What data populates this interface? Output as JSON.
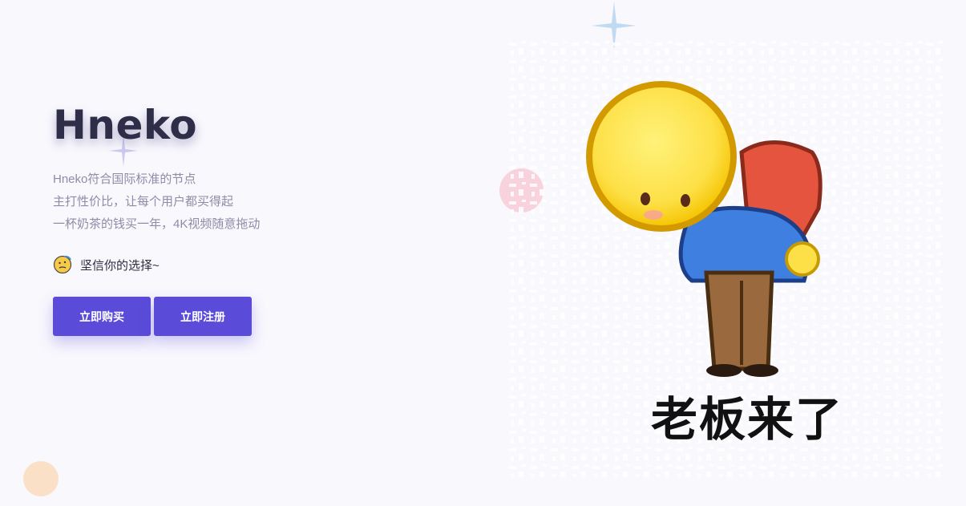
{
  "hero": {
    "brand": "Hneko",
    "tagline": [
      "Hneko符合国际标准的节点",
      "主打性价比，让每个用户都买得起",
      "一杯奶茶的钱买一年，4K视频随意拖动"
    ],
    "motto": "坚信你的选择~",
    "motto_icon": "thinking-face-icon",
    "buttons": {
      "buy": "立即购买",
      "register": "立即注册"
    }
  },
  "illustration": {
    "caption": "老板来了",
    "icon": "bowing-emoji-character"
  },
  "colors": {
    "background": "#f9f8fd",
    "primary": "#5b4bd9",
    "brand_text": "#2f2e48",
    "tagline_text": "#8e8ca6",
    "pink_bubble": "#f8d3de",
    "peach_bubble": "#fbe0c8"
  }
}
